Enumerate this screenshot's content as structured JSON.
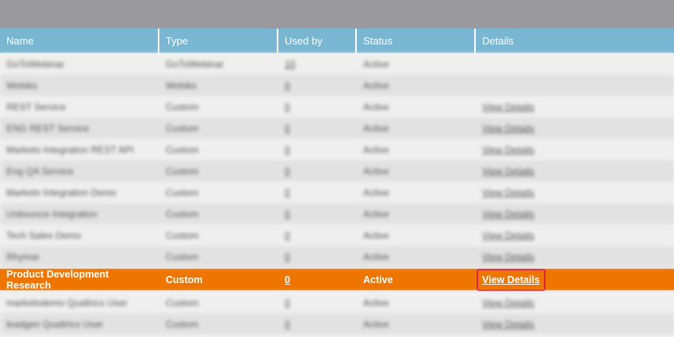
{
  "columns": [
    "Name",
    "Type",
    "Used by",
    "Status",
    "Details"
  ],
  "rows_before": [
    {
      "name": "GoToWebinar",
      "type": "GoToWebinar",
      "used_by": "10",
      "status": "Active",
      "details": ""
    },
    {
      "name": "Webiks",
      "type": "Webiks",
      "used_by": "0",
      "status": "Active",
      "details": ""
    },
    {
      "name": "REST Service",
      "type": "Custom",
      "used_by": "0",
      "status": "Active",
      "details": "View Details"
    },
    {
      "name": "ENG REST Service",
      "type": "Custom",
      "used_by": "0",
      "status": "Active",
      "details": "View Details"
    },
    {
      "name": "Marketo Integration REST API",
      "type": "Custom",
      "used_by": "0",
      "status": "Active",
      "details": "View Details"
    },
    {
      "name": "Eng QA Service",
      "type": "Custom",
      "used_by": "0",
      "status": "Active",
      "details": "View Details"
    },
    {
      "name": "Marketo Integration Demo",
      "type": "Custom",
      "used_by": "0",
      "status": "Active",
      "details": "View Details"
    },
    {
      "name": "Unbounce Integration",
      "type": "Custom",
      "used_by": "0",
      "status": "Active",
      "details": "View Details"
    },
    {
      "name": "Tech Sales Demo",
      "type": "Custom",
      "used_by": "0",
      "status": "Active",
      "details": "View Details"
    },
    {
      "name": "Rhymar",
      "type": "Custom",
      "used_by": "0",
      "status": "Active",
      "details": "View Details"
    }
  ],
  "selected": {
    "name": "Product Development Research",
    "type": "Custom",
    "used_by": "0",
    "status": "Active",
    "details": "View Details"
  },
  "rows_after": [
    {
      "name": "marketodemo Qualtrics User",
      "type": "Custom",
      "used_by": "0",
      "status": "Active",
      "details": "View Details"
    },
    {
      "name": "leadgen Qualtrics User",
      "type": "Custom",
      "used_by": "0",
      "status": "Active",
      "details": "View Details"
    }
  ]
}
